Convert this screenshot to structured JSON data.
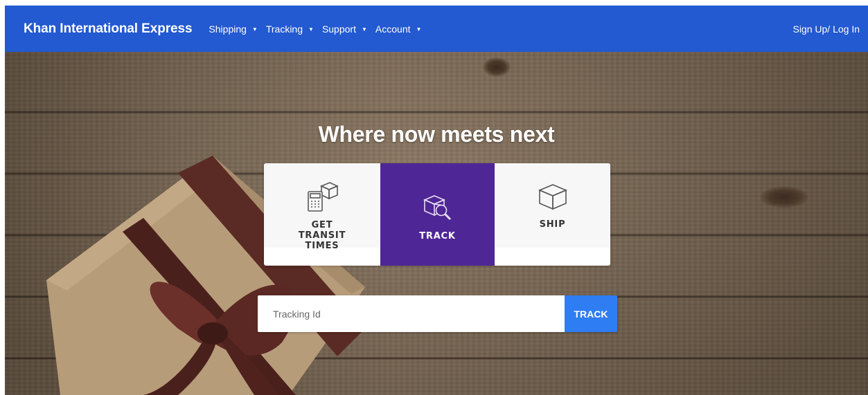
{
  "navbar": {
    "brand": "Khan International Express",
    "menu": [
      {
        "label": "Shipping",
        "caret": "▼"
      },
      {
        "label": "Tracking",
        "caret": "▼"
      },
      {
        "label": "Support",
        "caret": "▼"
      },
      {
        "label": "Account",
        "caret": "▼"
      }
    ],
    "auth_link": "Sign Up/ Log In"
  },
  "hero": {
    "title": "Where now meets next",
    "options": [
      {
        "label": "GET TRANSIT TIMES",
        "icon": "transit-calculator-icon",
        "selected": false
      },
      {
        "label": "TRACK",
        "icon": "track-package-search-icon",
        "selected": true
      },
      {
        "label": "SHIP",
        "icon": "ship-box-icon",
        "selected": false
      }
    ]
  },
  "tracking_form": {
    "placeholder": "Tracking Id",
    "value": "",
    "button_label": "TRACK"
  },
  "colors": {
    "navbar": "#2359d1",
    "selected_option": "#4f2696",
    "track_button": "#2e7df2"
  }
}
